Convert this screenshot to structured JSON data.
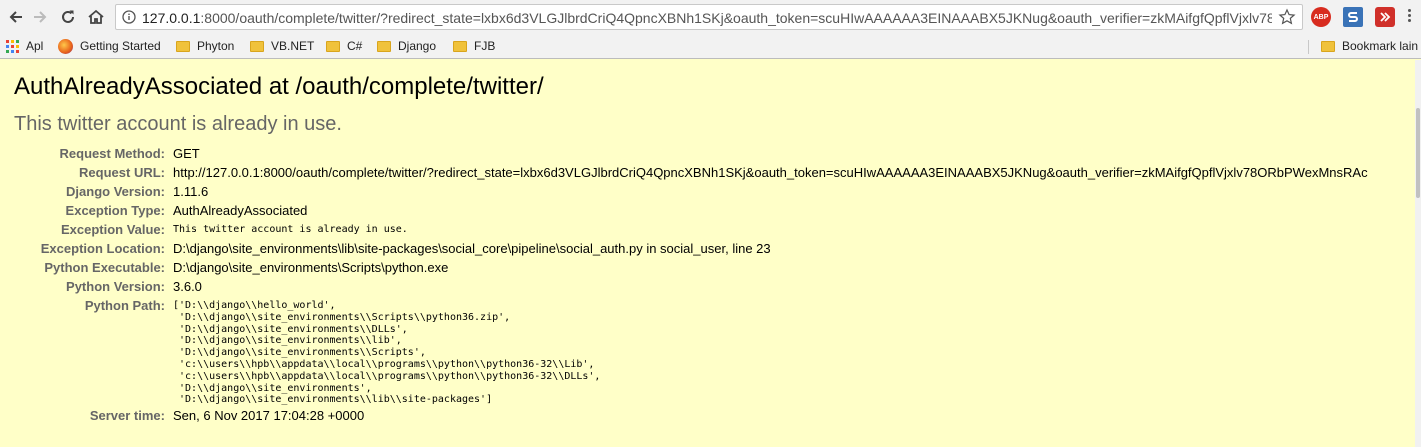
{
  "browser": {
    "url_host": "127.0.0.1",
    "url_rest": ":8000/oauth/complete/twitter/?redirect_state=lxbx6d3VLGJlbrdCriQ4QpncXBNh1SKj&oauth_token=scuHIwAAAAAA3EINAAABX5JKNug&oauth_verifier=zkMAifgfQpflVjxlv78...",
    "ext_abp": "ABP"
  },
  "bookmarks": {
    "items": [
      {
        "label": "Apl"
      },
      {
        "label": "Getting Started"
      },
      {
        "label": "Phyton"
      },
      {
        "label": "VB.NET"
      },
      {
        "label": "C#"
      },
      {
        "label": "Django"
      },
      {
        "label": "FJB"
      }
    ],
    "other": "Bookmark lain"
  },
  "error": {
    "title": "AuthAlreadyAssociated at /oauth/complete/twitter/",
    "subtitle": "This twitter account is already in use.",
    "rows": [
      {
        "label": "Request Method:",
        "value": "GET"
      },
      {
        "label": "Request URL:",
        "value": "http://127.0.0.1:8000/oauth/complete/twitter/?redirect_state=lxbx6d3VLGJlbrdCriQ4QpncXBNh1SKj&oauth_token=scuHIwAAAAAA3EINAAABX5JKNug&oauth_verifier=zkMAifgfQpflVjxlv78ORbPWexMnsRAc"
      },
      {
        "label": "Django Version:",
        "value": "1.11.6"
      },
      {
        "label": "Exception Type:",
        "value": "AuthAlreadyAssociated"
      },
      {
        "label": "Exception Value:",
        "value": "This twitter account is already in use."
      },
      {
        "label": "Exception Location:",
        "value": "D:\\django\\site_environments\\lib\\site-packages\\social_core\\pipeline\\social_auth.py in social_user, line 23"
      },
      {
        "label": "Python Executable:",
        "value": "D:\\django\\site_environments\\Scripts\\python.exe"
      },
      {
        "label": "Python Version:",
        "value": "3.6.0"
      }
    ],
    "python_path_label": "Python Path:",
    "python_path": [
      "['D:\\\\django\\\\hello_world',",
      " 'D:\\\\django\\\\site_environments\\\\Scripts\\\\python36.zip',",
      " 'D:\\\\django\\\\site_environments\\\\DLLs',",
      " 'D:\\\\django\\\\site_environments\\\\lib',",
      " 'D:\\\\django\\\\site_environments\\\\Scripts',",
      " 'c:\\\\users\\\\hpb\\\\appdata\\\\local\\\\programs\\\\python\\\\python36-32\\\\Lib',",
      " 'c:\\\\users\\\\hpb\\\\appdata\\\\local\\\\programs\\\\python\\\\python36-32\\\\DLLs',",
      " 'D:\\\\django\\\\site_environments',",
      " 'D:\\\\django\\\\site_environments\\\\lib\\\\site-packages']"
    ],
    "server_time_label": "Server time:",
    "server_time": "Sen, 6 Nov 2017 17:04:28 +0000"
  }
}
